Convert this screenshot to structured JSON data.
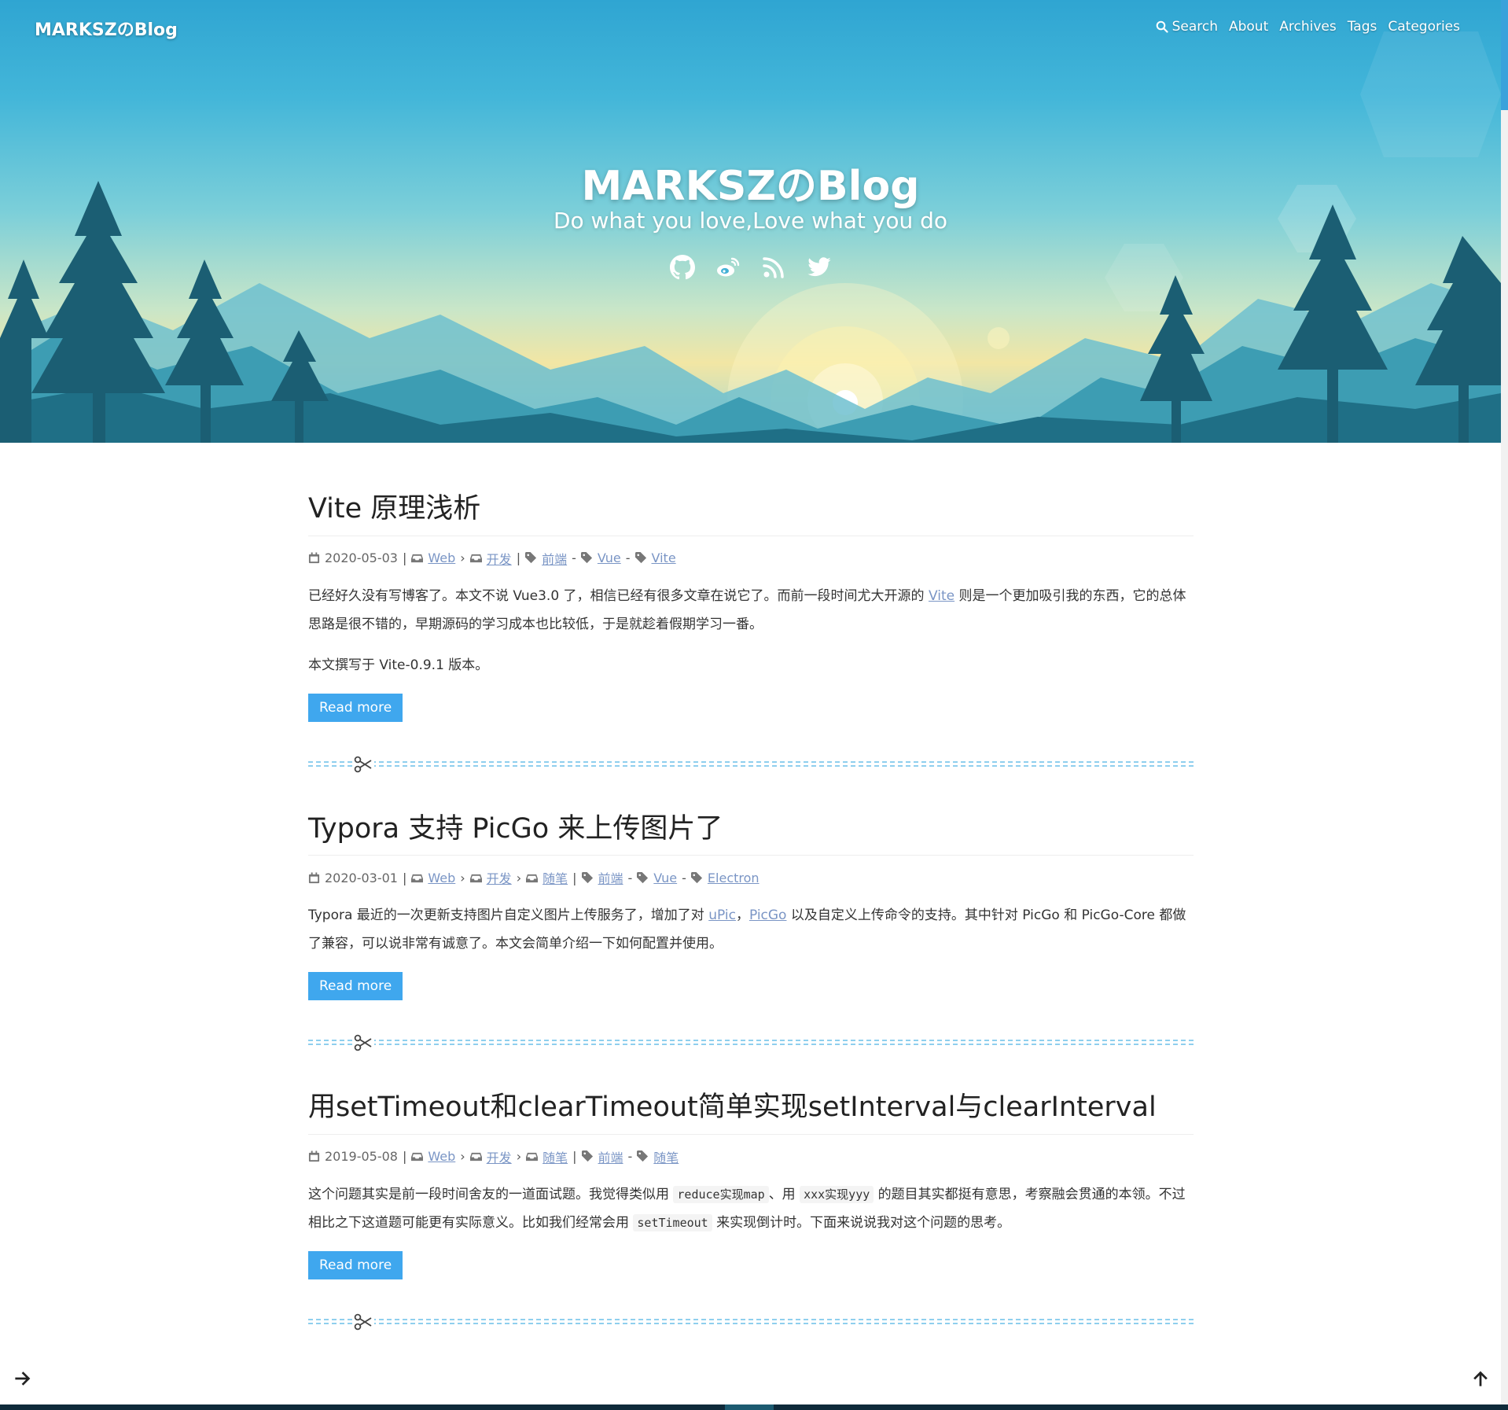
{
  "nav": {
    "brand": "MARKSZのBlog",
    "items": [
      {
        "label": "Search",
        "icon": "search-icon"
      },
      {
        "label": "About"
      },
      {
        "label": "Archives"
      },
      {
        "label": "Tags"
      },
      {
        "label": "Categories"
      }
    ]
  },
  "hero": {
    "title": "MARKSZのBlog",
    "subtitle": "Do what you love,Love what you do",
    "social": [
      "github-icon",
      "weibo-icon",
      "rss-icon",
      "twitter-icon"
    ]
  },
  "posts": [
    {
      "title": "Vite 原理浅析",
      "date": "2020-05-03",
      "categories": [
        "Web",
        "开发"
      ],
      "tags": [
        "前端",
        "Vue",
        "Vite"
      ],
      "excerpt": {
        "p1_a": "已经好久没有写博客了。本文不说 Vue3.0 了，相信已经有很多文章在说它了。而前一段时间尤大开源的 ",
        "p1_link": "Vite",
        "p1_b": " 则是一个更加吸引我的东西，它的总体思路是很不错的，早期源码的学习成本也比较低，于是就趁着假期学习一番。",
        "p2": "本文撰写于 Vite-0.9.1 版本。"
      },
      "read_more": "Read more"
    },
    {
      "title": "Typora 支持 PicGo 来上传图片了",
      "date": "2020-03-01",
      "categories": [
        "Web",
        "开发",
        "随笔"
      ],
      "tags": [
        "前端",
        "Vue",
        "Electron"
      ],
      "excerpt": {
        "p1_a": "Typora 最近的一次更新支持图片自定义图片上传服务了，增加了对 ",
        "p1_link1": "uPic",
        "p1_mid": "，",
        "p1_link2": "PicGo",
        "p1_b": " 以及自定义上传命令的支持。其中针对 PicGo 和 PicGo-Core 都做了兼容，可以说非常有诚意了。本文会简单介绍一下如何配置并使用。"
      },
      "read_more": "Read more"
    },
    {
      "title": "用setTimeout和clearTimeout简单实现setInterval与clearInterval",
      "date": "2019-05-08",
      "categories": [
        "Web",
        "开发",
        "随笔"
      ],
      "tags": [
        "前端",
        "随笔"
      ],
      "excerpt": {
        "p1_a": "这个问题其实是前一段时间舍友的一道面试题。我觉得类似用 ",
        "p1_code1": "reduce实现map",
        "p1_mid": "、用 ",
        "p1_code2": "xxx实现yyy",
        "p1_b": " 的题目其实都挺有意思，考察融会贯通的本领。不过相比之下这道题可能更有实际意义。比如我们经常会用 ",
        "p1_code3": "setTimeout",
        "p1_c": " 来实现倒计时。下面来说说我对这个问题的思考。"
      },
      "read_more": "Read more"
    }
  ],
  "colors": {
    "accent": "#3fa7ee",
    "link": "#7a95c5",
    "divider": "#8fcfee",
    "footer": "#0f2a3a"
  },
  "floating": [
    "arrow-right-icon",
    "arrow-up-icon"
  ]
}
